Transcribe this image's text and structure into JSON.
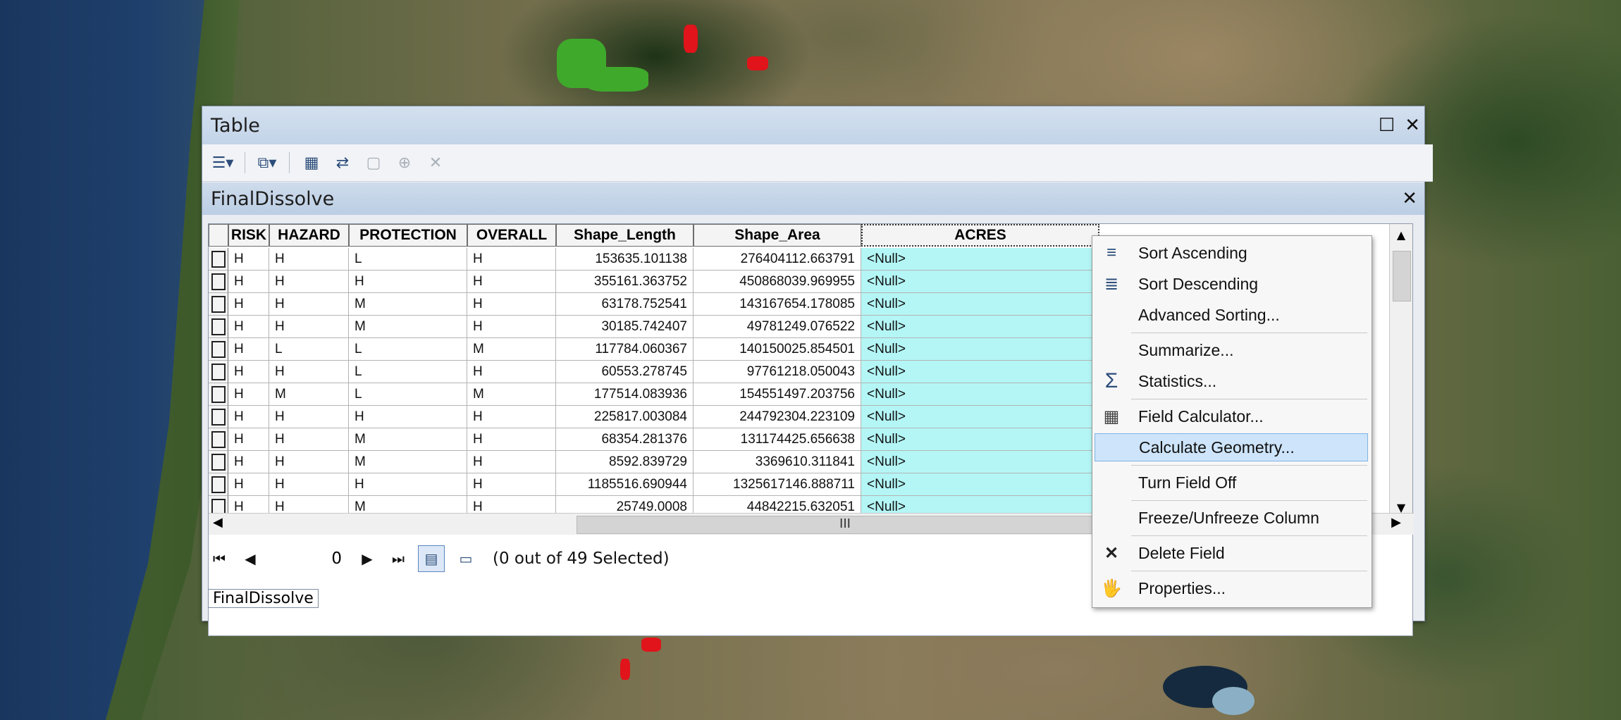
{
  "window": {
    "title": "Table",
    "maximize_glyph": "☐",
    "close_glyph": "✕"
  },
  "toolbar": {
    "icons": [
      "table-options-icon",
      "related-tables-icon",
      "select-by-attributes-icon",
      "switch-selection-icon",
      "clear-selection-icon",
      "zoom-to-selected-icon",
      "delete-selected-icon"
    ]
  },
  "layer": {
    "name": "FinalDissolve",
    "close_glyph": "✕"
  },
  "grid": {
    "columns": [
      "RISK",
      "HAZARD",
      "PROTECTION",
      "OVERALL",
      "Shape_Length",
      "Shape_Area",
      "ACRES"
    ],
    "rows": [
      [
        "H",
        "H",
        "L",
        "H",
        "153635.101138",
        "276404112.663791",
        "<Null>"
      ],
      [
        "H",
        "H",
        "H",
        "H",
        "355161.363752",
        "450868039.969955",
        "<Null>"
      ],
      [
        "H",
        "H",
        "M",
        "H",
        "63178.752541",
        "143167654.178085",
        "<Null>"
      ],
      [
        "H",
        "H",
        "M",
        "H",
        "30185.742407",
        "49781249.076522",
        "<Null>"
      ],
      [
        "H",
        "L",
        "L",
        "M",
        "117784.060367",
        "140150025.854501",
        "<Null>"
      ],
      [
        "H",
        "H",
        "L",
        "H",
        "60553.278745",
        "97761218.050043",
        "<Null>"
      ],
      [
        "H",
        "M",
        "L",
        "M",
        "177514.083936",
        "154551497.203756",
        "<Null>"
      ],
      [
        "H",
        "H",
        "H",
        "H",
        "225817.003084",
        "244792304.223109",
        "<Null>"
      ],
      [
        "H",
        "H",
        "M",
        "H",
        "68354.281376",
        "131174425.656638",
        "<Null>"
      ],
      [
        "H",
        "H",
        "M",
        "H",
        "8592.839729",
        "3369610.311841",
        "<Null>"
      ],
      [
        "H",
        "H",
        "H",
        "H",
        "1185516.690944",
        "1325617146.888711",
        "<Null>"
      ],
      [
        "H",
        "H",
        "M",
        "H",
        "25749.0008",
        "44842215.632051",
        "<Null>"
      ]
    ],
    "selected_column": "ACRES",
    "hscroll_thumb_glyph": "III"
  },
  "navigation": {
    "current_record": "0",
    "status": "(0 out of 49 Selected)"
  },
  "tabs": [
    "FinalDissolve"
  ],
  "context_menu": {
    "items": [
      {
        "label": "Sort Ascending",
        "icon": "sort-ascending-icon"
      },
      {
        "label": "Sort Descending",
        "icon": "sort-descending-icon"
      },
      {
        "label": "Advanced Sorting...",
        "icon": ""
      },
      {
        "label": "Summarize...",
        "icon": ""
      },
      {
        "label": "Statistics...",
        "icon": "sigma-icon"
      },
      {
        "label": "Field Calculator...",
        "icon": "calculator-icon"
      },
      {
        "label": "Calculate Geometry...",
        "icon": "",
        "highlighted": true
      },
      {
        "label": "Turn Field Off",
        "icon": ""
      },
      {
        "label": "Freeze/Unfreeze Column",
        "icon": ""
      },
      {
        "label": "Delete Field",
        "icon": "delete-x-icon"
      },
      {
        "label": "Properties...",
        "icon": "properties-icon"
      }
    ]
  },
  "colors": {
    "selected_column": "#b4f6f6",
    "highlight": "#cde4fa"
  }
}
